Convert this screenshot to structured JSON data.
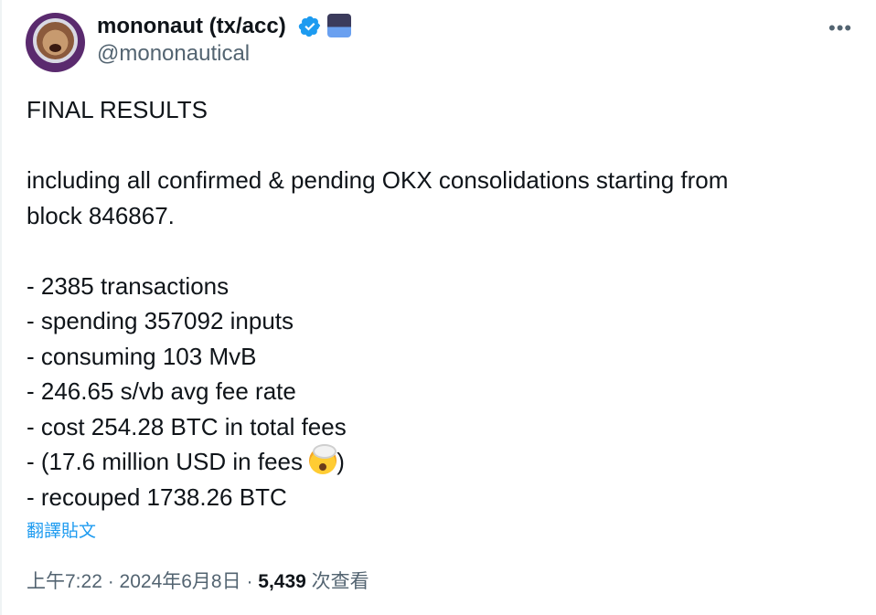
{
  "tweet": {
    "author": {
      "display_name": "mononaut (tx/acc)",
      "handle": "@mononautical",
      "verified": true,
      "avatar_icon": "astronaut-monkey-avatar",
      "badge_icon": "affiliate-badge-icon"
    },
    "more_icon": "ellipsis-icon",
    "body_lines": [
      "FINAL RESULTS",
      "",
      "including all confirmed & pending OKX consolidations starting from",
      "block 846867.",
      "",
      "- 2385 transactions",
      "- spending 357092 inputs",
      "- consuming 103 MvB",
      "- 246.65 s/vb avg fee rate",
      "- cost 254.28 BTC in total fees",
      "- (17.6 million USD in fees ",
      "- recouped 1738.26 BTC"
    ],
    "emoji_line_suffix": ")",
    "emoji": "exploding-head-emoji",
    "translate_label": "翻譯貼文",
    "timestamp": "上午7:22 · 2024年6月8日",
    "separator": " · ",
    "views_count": "5,439",
    "views_label": " 次查看"
  },
  "colors": {
    "link": "#1d9bf0",
    "secondary_text": "#536471",
    "primary_text": "#0f1419",
    "verified": "#1d9bf0"
  }
}
